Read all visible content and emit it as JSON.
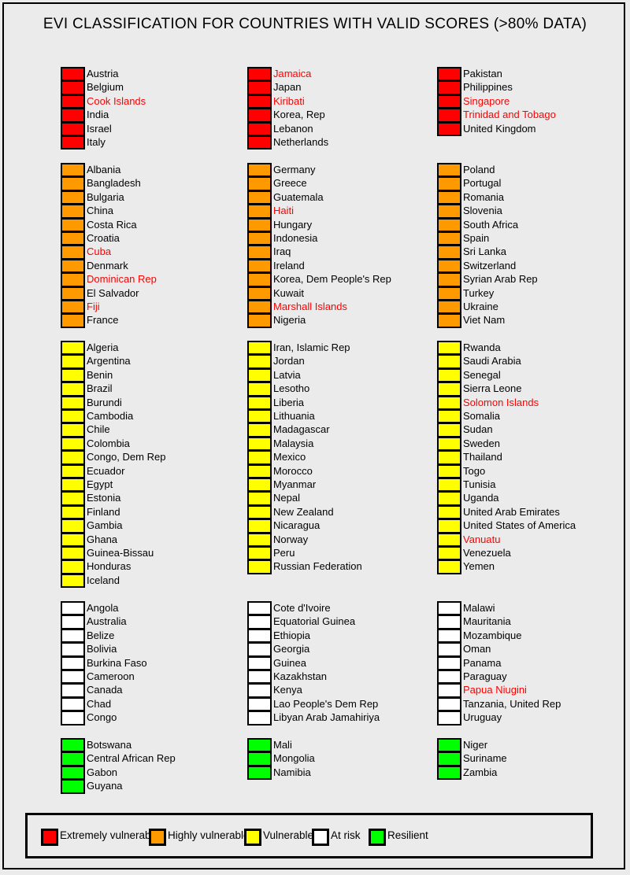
{
  "title": "EVI CLASSIFICATION FOR COUNTRIES WITH VALID SCORES (>80% DATA)",
  "colors": {
    "extremely_vulnerable": "#ff0000",
    "highly_vulnerable": "#ff9900",
    "vulnerable": "#ffff00",
    "at_risk": "#ffffff",
    "resilient": "#00ff00",
    "highlighted_text": "#ff0000"
  },
  "groups": [
    {
      "category": "extremely_vulnerable",
      "columns": [
        [
          {
            "name": "Austria"
          },
          {
            "name": "Belgium"
          },
          {
            "name": "Cook Islands",
            "highlighted": true
          },
          {
            "name": "India"
          },
          {
            "name": "Israel"
          },
          {
            "name": "Italy"
          }
        ],
        [
          {
            "name": "Jamaica",
            "highlighted": true
          },
          {
            "name": "Japan"
          },
          {
            "name": "Kiribati",
            "highlighted": true
          },
          {
            "name": "Korea, Rep"
          },
          {
            "name": "Lebanon"
          },
          {
            "name": "Netherlands"
          }
        ],
        [
          {
            "name": "Pakistan"
          },
          {
            "name": "Philippines"
          },
          {
            "name": "Singapore",
            "highlighted": true
          },
          {
            "name": "Trinidad and Tobago",
            "highlighted": true
          },
          {
            "name": "United Kingdom"
          }
        ]
      ]
    },
    {
      "category": "highly_vulnerable",
      "columns": [
        [
          {
            "name": "Albania"
          },
          {
            "name": "Bangladesh"
          },
          {
            "name": "Bulgaria"
          },
          {
            "name": "China"
          },
          {
            "name": "Costa Rica"
          },
          {
            "name": "Croatia"
          },
          {
            "name": "Cuba",
            "highlighted": true
          },
          {
            "name": "Denmark"
          },
          {
            "name": "Dominican Rep",
            "highlighted": true
          },
          {
            "name": "El Salvador"
          },
          {
            "name": "Fiji",
            "highlighted": true
          },
          {
            "name": "France"
          }
        ],
        [
          {
            "name": "Germany"
          },
          {
            "name": "Greece"
          },
          {
            "name": "Guatemala"
          },
          {
            "name": "Haiti",
            "highlighted": true
          },
          {
            "name": "Hungary"
          },
          {
            "name": "Indonesia"
          },
          {
            "name": "Iraq"
          },
          {
            "name": "Ireland"
          },
          {
            "name": "Korea, Dem People's Rep"
          },
          {
            "name": "Kuwait"
          },
          {
            "name": "Marshall Islands",
            "highlighted": true
          },
          {
            "name": "Nigeria"
          }
        ],
        [
          {
            "name": "Poland"
          },
          {
            "name": "Portugal"
          },
          {
            "name": "Romania"
          },
          {
            "name": "Slovenia"
          },
          {
            "name": "South Africa"
          },
          {
            "name": "Spain"
          },
          {
            "name": "Sri Lanka"
          },
          {
            "name": "Switzerland"
          },
          {
            "name": "Syrian Arab Rep"
          },
          {
            "name": "Turkey"
          },
          {
            "name": "Ukraine"
          },
          {
            "name": "Viet Nam"
          }
        ]
      ]
    },
    {
      "category": "vulnerable",
      "columns": [
        [
          {
            "name": "Algeria"
          },
          {
            "name": "Argentina"
          },
          {
            "name": "Benin"
          },
          {
            "name": "Brazil"
          },
          {
            "name": "Burundi"
          },
          {
            "name": "Cambodia"
          },
          {
            "name": "Chile"
          },
          {
            "name": "Colombia"
          },
          {
            "name": "Congo, Dem Rep"
          },
          {
            "name": "Ecuador"
          },
          {
            "name": "Egypt"
          },
          {
            "name": "Estonia"
          },
          {
            "name": "Finland"
          },
          {
            "name": "Gambia"
          },
          {
            "name": "Ghana"
          },
          {
            "name": "Guinea-Bissau"
          },
          {
            "name": "Honduras"
          },
          {
            "name": "Iceland"
          }
        ],
        [
          {
            "name": "Iran, Islamic Rep"
          },
          {
            "name": "Jordan"
          },
          {
            "name": "Latvia"
          },
          {
            "name": "Lesotho"
          },
          {
            "name": "Liberia"
          },
          {
            "name": "Lithuania"
          },
          {
            "name": "Madagascar"
          },
          {
            "name": "Malaysia"
          },
          {
            "name": "Mexico"
          },
          {
            "name": "Morocco"
          },
          {
            "name": "Myanmar"
          },
          {
            "name": "Nepal"
          },
          {
            "name": "New Zealand"
          },
          {
            "name": "Nicaragua"
          },
          {
            "name": "Norway"
          },
          {
            "name": "Peru"
          },
          {
            "name": "Russian Federation"
          }
        ],
        [
          {
            "name": "Rwanda"
          },
          {
            "name": "Saudi Arabia"
          },
          {
            "name": "Senegal"
          },
          {
            "name": "Sierra Leone"
          },
          {
            "name": "Solomon Islands",
            "highlighted": true
          },
          {
            "name": "Somalia"
          },
          {
            "name": "Sudan"
          },
          {
            "name": "Sweden"
          },
          {
            "name": "Thailand"
          },
          {
            "name": "Togo"
          },
          {
            "name": "Tunisia"
          },
          {
            "name": "Uganda"
          },
          {
            "name": "United Arab Emirates"
          },
          {
            "name": "United States of America"
          },
          {
            "name": "Vanuatu",
            "highlighted": true
          },
          {
            "name": "Venezuela"
          },
          {
            "name": "Yemen"
          }
        ]
      ]
    },
    {
      "category": "at_risk",
      "columns": [
        [
          {
            "name": "Angola"
          },
          {
            "name": "Australia"
          },
          {
            "name": "Belize"
          },
          {
            "name": "Bolivia"
          },
          {
            "name": "Burkina Faso"
          },
          {
            "name": "Cameroon"
          },
          {
            "name": "Canada"
          },
          {
            "name": "Chad"
          },
          {
            "name": "Congo"
          }
        ],
        [
          {
            "name": "Cote d'Ivoire"
          },
          {
            "name": "Equatorial Guinea"
          },
          {
            "name": "Ethiopia"
          },
          {
            "name": "Georgia"
          },
          {
            "name": "Guinea"
          },
          {
            "name": "Kazakhstan"
          },
          {
            "name": "Kenya"
          },
          {
            "name": "Lao People's Dem Rep"
          },
          {
            "name": "Libyan Arab Jamahiriya"
          }
        ],
        [
          {
            "name": "Malawi"
          },
          {
            "name": "Mauritania"
          },
          {
            "name": "Mozambique"
          },
          {
            "name": "Oman"
          },
          {
            "name": "Panama"
          },
          {
            "name": "Paraguay"
          },
          {
            "name": "Papua Niugini",
            "highlighted": true
          },
          {
            "name": "Tanzania, United Rep"
          },
          {
            "name": "Uruguay"
          }
        ]
      ]
    },
    {
      "category": "resilient",
      "columns": [
        [
          {
            "name": "Botswana"
          },
          {
            "name": "Central African Rep"
          },
          {
            "name": "Gabon"
          },
          {
            "name": "Guyana"
          }
        ],
        [
          {
            "name": "Mali"
          },
          {
            "name": "Mongolia"
          },
          {
            "name": "Namibia"
          }
        ],
        [
          {
            "name": "Niger"
          },
          {
            "name": "Suriname"
          },
          {
            "name": "Zambia"
          }
        ]
      ]
    }
  ],
  "legend": [
    {
      "category": "extremely_vulnerable",
      "label": "Extremely vulnerable"
    },
    {
      "category": "highly_vulnerable",
      "label": "Highly vulnerable"
    },
    {
      "category": "vulnerable",
      "label": "Vulnerable"
    },
    {
      "category": "at_risk",
      "label": "At risk"
    },
    {
      "category": "resilient",
      "label": "Resilient"
    }
  ]
}
